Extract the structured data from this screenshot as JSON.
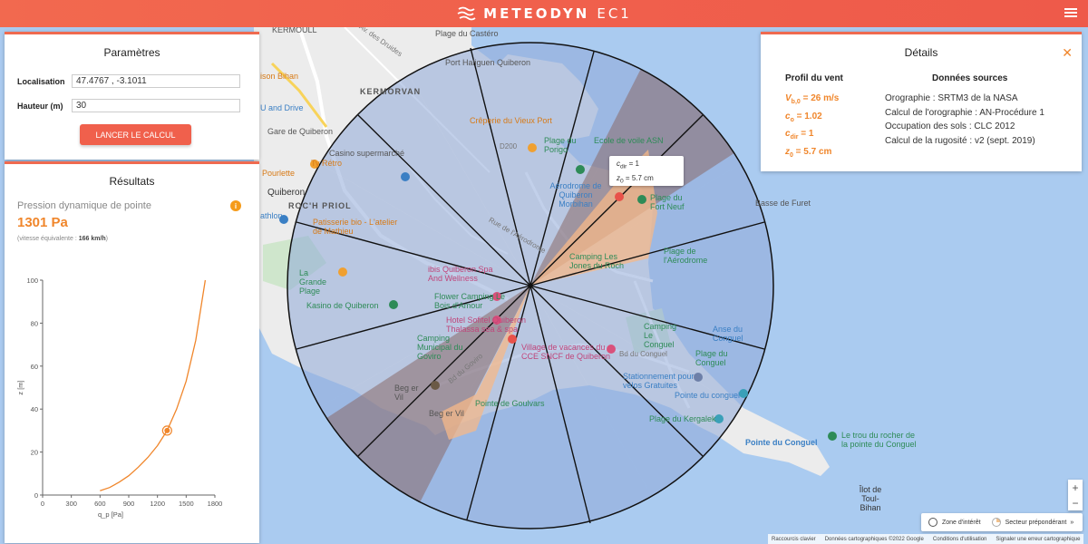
{
  "header": {
    "app_name": "METEODYN",
    "app_suffix": "EC1",
    "menu_icon": "hamburger-icon"
  },
  "params": {
    "title": "Paramètres",
    "location_label": "Localisation",
    "location_value": "47.4767 , -3.1011",
    "height_label": "Hauteur (m)",
    "height_value": "30",
    "calc_button": "LANCER LE CALCUL"
  },
  "results": {
    "title": "Résultats",
    "pressure_label": "Pression dynamique de pointe",
    "pressure_value": "1301 Pa",
    "speed_prefix": "(vitesse équivalente : ",
    "speed_value": "166 km/h",
    "speed_suffix": ")",
    "info_icon": "info-icon"
  },
  "chart_data": {
    "type": "line",
    "x": [
      600,
      700,
      800,
      900,
      1000,
      1100,
      1200,
      1301,
      1400,
      1500,
      1600,
      1700
    ],
    "y": [
      2,
      3.5,
      6,
      9,
      13,
      17.5,
      23,
      30,
      40,
      53,
      72,
      100
    ],
    "xlabel": "q_p [Pa]",
    "ylabel": "z [m]",
    "xlim": [
      0,
      1800
    ],
    "ylim": [
      0,
      100
    ],
    "xticks": [
      0,
      300,
      600,
      900,
      1200,
      1500,
      1800
    ],
    "yticks": [
      0,
      20,
      40,
      60,
      80,
      100
    ],
    "marker": {
      "x": 1301,
      "y": 30
    },
    "color": "#f0862b"
  },
  "details": {
    "title": "Détails",
    "left_header": "Profil du vent",
    "right_header": "Données sources",
    "profile": [
      {
        "sym": "V",
        "sub": "b,0",
        "val": " = 26 m/s"
      },
      {
        "sym": "c",
        "sub": "o",
        "val": " = 1.02"
      },
      {
        "sym": "c",
        "sub": "dir",
        "val": " = 1"
      },
      {
        "sym": "z",
        "sub": "0",
        "val": " = 5.7 cm"
      }
    ],
    "sources": [
      "Orographie : SRTM3 de la NASA",
      "Calcul de l'orographie : AN-Procédure 1",
      "Occupation des sols : CLC 2012",
      "Calcul de la rugosité : v2 (sept. 2019)"
    ]
  },
  "tooltip": {
    "line1_sym": "c",
    "line1_sub": "dir",
    "line1_val": " = 1",
    "line2_sym": "z",
    "line2_sub": "0",
    "line2_val": " = 5.7 cm"
  },
  "legend": {
    "zone": "Zone d'intérêt",
    "sector": "Secteur prépondérant"
  },
  "footer": [
    "Raccourcis clavier",
    "Données cartographiques ©2022 Google",
    "Conditions d'utilisation",
    "Signaler une erreur cartographique"
  ],
  "map_labels": {
    "castero": "Plage du Castéro",
    "port_haliguen": "Port Haliguen Quiberon",
    "kermorvan": "KERMORVAN",
    "creperie": "Crêperie du Vieux Port",
    "ecole": "Ecole de voile ASN",
    "plage_porigo": "Plage du Porigo",
    "casino": "Casino supermarché",
    "aerodrome": "Aérodrome de Quiberon Morbihan",
    "fort_neuf": "Plage du Fort Neuf",
    "furet": "Basse de Furet",
    "quiberon": "Quiberon",
    "roch_priol": "ROC'H PRIOL",
    "patisserie": "Patisserie bio - L'atelier de Mathieu",
    "camping_jones": "Camping Les Jones du Roch",
    "plage_aero": "Plage de l'Aérodrome",
    "grande_plage": "La Grande Plage",
    "ibis": "ibis Quiberon Spa And Wellness",
    "kasino": "Kasino de Quiberon",
    "flower": "Flower Camping Le Bois d'Amour",
    "sofitel": "Hotel Sofitel Quiberon Thalassa sea & spa",
    "camping_conguel": "Camping Le Conguel",
    "anse": "Anse du Conguel",
    "camping_goviro": "Camping Municipal du Goviro",
    "village": "Village de vacances du CCE SNCF de Quiberon",
    "plage_conguel": "Plage du Conguel",
    "stationnement": "Stationnement pour vélos Gratuites",
    "beg_er_vil": "Beg er Vil",
    "goulvars": "Pointe de Goulvars",
    "pointe_conguel_blue": "Pointe du conguel",
    "kergalek": "Plage du Kergalek",
    "pointe_conguel": "Pointe du Conguel",
    "trou": "Le trou du rocher de la pointe du Conguel",
    "ilot": "Îlot de Toul-Bihan",
    "ty_retro": "Ty Rétro",
    "pourlette": "Pourlette",
    "bihan": "ison Bihan",
    "drive": "U and Drive",
    "gare": "Gare de Quiberon",
    "dthlon": "athlon",
    "kermoull": "KERMOULL",
    "av_druides": "Av. des Druides",
    "bd_goviro": "Bd du Goviro",
    "bd_conguel": "Bd du Conguel",
    "rue_aerodrome": "Rue de l'Aérodrome",
    "d200": "D200"
  }
}
